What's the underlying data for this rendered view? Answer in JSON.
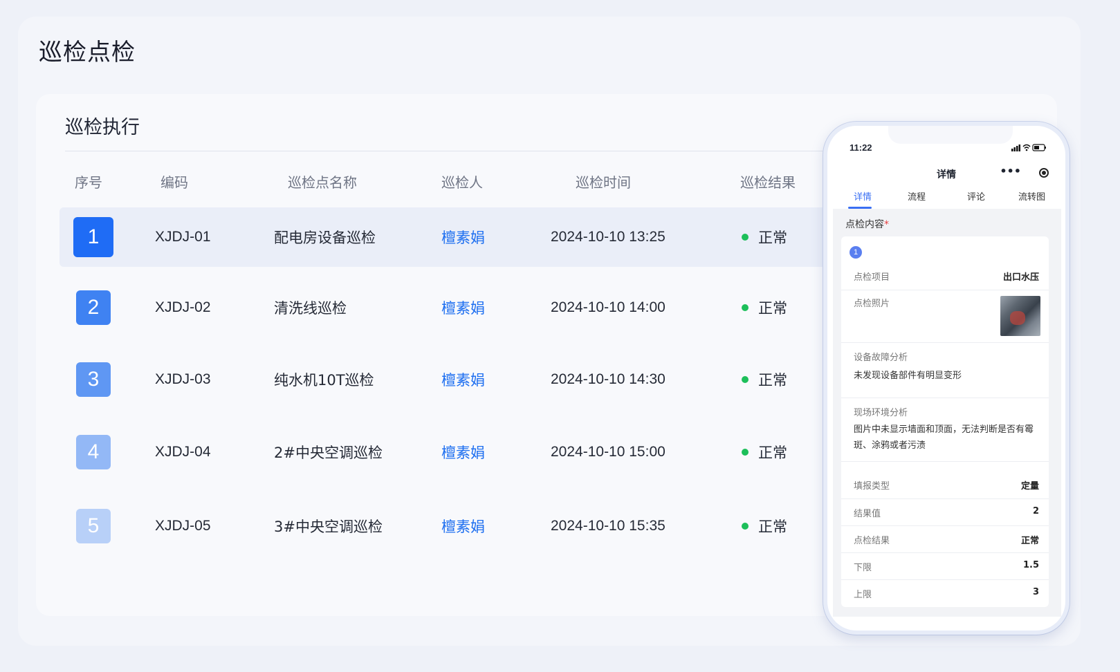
{
  "page": {
    "title": "巡检点检"
  },
  "card": {
    "title": "巡检执行"
  },
  "table": {
    "headers": [
      "序号",
      "编码",
      "巡检点名称",
      "巡检人",
      "巡检时间",
      "巡检结果"
    ],
    "rows": [
      {
        "index": "1",
        "code": "XJDJ-01",
        "name": "配电房设备巡检",
        "inspector": "檀素娟",
        "time": "2024-10-10 13:25",
        "result": "正常"
      },
      {
        "index": "2",
        "code": "XJDJ-02",
        "name": "清洗线巡检",
        "inspector": "檀素娟",
        "time": "2024-10-10 14:00",
        "result": "正常"
      },
      {
        "index": "3",
        "code": "XJDJ-03",
        "name": "纯水机10T巡检",
        "inspector": "檀素娟",
        "time": "2024-10-10 14:30",
        "result": "正常"
      },
      {
        "index": "4",
        "code": "XJDJ-04",
        "name": "2#中央空调巡检",
        "inspector": "檀素娟",
        "time": "2024-10-10 15:00",
        "result": "正常"
      },
      {
        "index": "5",
        "code": "XJDJ-05",
        "name": "3#中央空调巡检",
        "inspector": "檀素娟",
        "time": "2024-10-10 15:35",
        "result": "正常"
      }
    ],
    "index_colors": [
      "#1f6cf5",
      "#3f82f2",
      "#5f97f3",
      "#93b8f6",
      "#b8d0f8"
    ],
    "status_color": "#1dbf5a"
  },
  "phone": {
    "time": "11:22",
    "status_icons": "signal wifi battery",
    "header_title": "详情",
    "more": "•••",
    "tabs": [
      "详情",
      "流程",
      "评论",
      "流转图"
    ],
    "section_title": "点检内容",
    "section_required": "*",
    "item_no": "1",
    "fields": {
      "item_label": "点检项目",
      "item_value": "出口水压",
      "photo_label": "点检照片",
      "fault_label": "设备故障分析",
      "fault_value": "未发现设备部件有明显变形",
      "env_label": "现场环境分析",
      "env_value": "图片中未显示墙面和顶面，无法判断是否有霉斑、涂鸦或者污渍",
      "type_label": "填报类型",
      "type_value": "定量",
      "result_value_label": "结果值",
      "result_value": "2",
      "check_result_label": "点检结果",
      "check_result": "正常",
      "lower_label": "下限",
      "lower_value": "1.5",
      "upper_label": "上限",
      "upper_value": "3"
    },
    "accent": "#3a6ff3"
  }
}
